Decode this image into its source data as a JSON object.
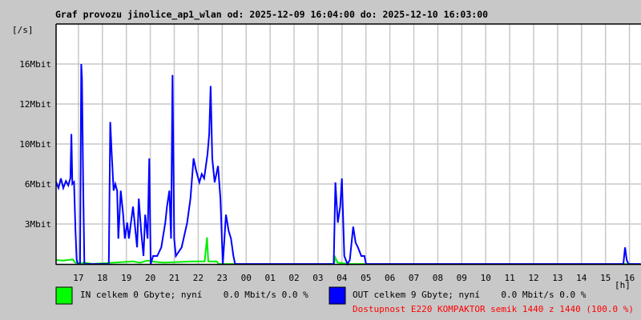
{
  "chart_data": {
    "type": "line",
    "title": "Graf provozu jinolice_ap1_wlan od: 2025-12-09 16:04:00 do: 2025-12-10 16:03:00",
    "ylabel": "[/s]",
    "xlabel": "[h]",
    "y_ticks": [
      {
        "label": "3Mbit",
        "value": 3
      },
      {
        "label": "6Mbit",
        "value": 6
      },
      {
        "label": "10Mbit",
        "value": 10
      },
      {
        "label": "12Mbit",
        "value": 12
      },
      {
        "label": "16Mbit",
        "value": 16
      }
    ],
    "x_start": "16:04",
    "x_ticks": [
      "17",
      "18",
      "19",
      "20",
      "21",
      "22",
      "23",
      "00",
      "01",
      "02",
      "03",
      "04",
      "05",
      "06",
      "07",
      "08",
      "09",
      "10",
      "11",
      "12",
      "13",
      "14",
      "15",
      "16"
    ],
    "grid": true,
    "series": [
      {
        "name": "IN",
        "color": "#00ee00",
        "points": [
          [
            0,
            0.3
          ],
          [
            0.3,
            0.25
          ],
          [
            0.5,
            0.3
          ],
          [
            0.7,
            0.35
          ],
          [
            0.8,
            0.1
          ],
          [
            1.0,
            0.05
          ],
          [
            1.2,
            0.1
          ],
          [
            1.5,
            0
          ],
          [
            3.2,
            0.2
          ],
          [
            3.5,
            0.1
          ],
          [
            3.8,
            0.25
          ],
          [
            4.2,
            0.15
          ],
          [
            4.5,
            0.1
          ],
          [
            5.7,
            0.2
          ],
          [
            6.2,
            0.2
          ],
          [
            6.3,
            2.0
          ],
          [
            6.35,
            0.2
          ],
          [
            6.7,
            0.2
          ],
          [
            6.8,
            0
          ],
          [
            11.6,
            0
          ],
          [
            11.65,
            0.5
          ],
          [
            11.75,
            0.1
          ],
          [
            12.0,
            0.05
          ],
          [
            12.3,
            0
          ],
          [
            24.4,
            0
          ]
        ]
      },
      {
        "name": "OUT",
        "color": "#0000ff",
        "points": [
          [
            0,
            6.2
          ],
          [
            0.1,
            5.7
          ],
          [
            0.2,
            6.56
          ],
          [
            0.3,
            5.7
          ],
          [
            0.41,
            6.3
          ],
          [
            0.51,
            5.9
          ],
          [
            0.6,
            6.6
          ],
          [
            0.64,
            10.5
          ],
          [
            0.68,
            6.0
          ],
          [
            0.75,
            6.2
          ],
          [
            0.81,
            2.5
          ],
          [
            0.86,
            0.3
          ],
          [
            0.91,
            0
          ],
          [
            1.0,
            0
          ],
          [
            1.05,
            16
          ],
          [
            1.08,
            14.6
          ],
          [
            1.13,
            6.0
          ],
          [
            1.18,
            0
          ],
          [
            2.2,
            0
          ],
          [
            2.26,
            11.1
          ],
          [
            2.33,
            8.56
          ],
          [
            2.4,
            5.5
          ],
          [
            2.47,
            6.0
          ],
          [
            2.55,
            5.5
          ],
          [
            2.6,
            1.9
          ],
          [
            2.7,
            5.5
          ],
          [
            2.8,
            3.7
          ],
          [
            2.87,
            1.9
          ],
          [
            2.97,
            3.1
          ],
          [
            3.04,
            1.9
          ],
          [
            3.21,
            4.3
          ],
          [
            3.38,
            1.25
          ],
          [
            3.45,
            4.9
          ],
          [
            3.55,
            2.5
          ],
          [
            3.65,
            0.6
          ],
          [
            3.72,
            3.7
          ],
          [
            3.82,
            1.9
          ],
          [
            3.89,
            8.56
          ],
          [
            3.95,
            0
          ],
          [
            4.05,
            0.6
          ],
          [
            4.22,
            0.6
          ],
          [
            4.39,
            1.25
          ],
          [
            4.56,
            3.1
          ],
          [
            4.63,
            4.3
          ],
          [
            4.73,
            5.5
          ],
          [
            4.8,
            1.9
          ],
          [
            4.86,
            14.9
          ],
          [
            4.93,
            1.9
          ],
          [
            5.0,
            0.6
          ],
          [
            5.24,
            1.25
          ],
          [
            5.47,
            3.1
          ],
          [
            5.61,
            4.9
          ],
          [
            5.74,
            8.56
          ],
          [
            5.84,
            7.4
          ],
          [
            5.98,
            6.16
          ],
          [
            6.08,
            7.0
          ],
          [
            6.18,
            6.56
          ],
          [
            6.32,
            9.0
          ],
          [
            6.39,
            10.5
          ],
          [
            6.45,
            13.8
          ],
          [
            6.52,
            8.56
          ],
          [
            6.62,
            6.16
          ],
          [
            6.76,
            7.8
          ],
          [
            6.86,
            4.9
          ],
          [
            6.96,
            0
          ],
          [
            7.09,
            3.7
          ],
          [
            7.2,
            2.5
          ],
          [
            7.3,
            1.9
          ],
          [
            7.4,
            0.6
          ],
          [
            7.47,
            0
          ],
          [
            11.59,
            0
          ],
          [
            11.66,
            6.16
          ],
          [
            11.76,
            3.1
          ],
          [
            11.86,
            4.3
          ],
          [
            11.93,
            6.56
          ],
          [
            12.03,
            0.6
          ],
          [
            12.16,
            0
          ],
          [
            12.26,
            0.3
          ],
          [
            12.4,
            2.8
          ],
          [
            12.5,
            1.6
          ],
          [
            12.6,
            1.25
          ],
          [
            12.74,
            0.6
          ],
          [
            12.87,
            0.6
          ],
          [
            12.94,
            0
          ],
          [
            23.68,
            0
          ],
          [
            23.75,
            1.25
          ],
          [
            23.82,
            0.3
          ],
          [
            23.89,
            0
          ],
          [
            24.4,
            0
          ]
        ]
      }
    ]
  },
  "legend": {
    "in_text": "IN celkem 0 Gbyte; nyní    0.0 Mbit/s 0.0 %",
    "out_text": "OUT celkem 9 Gbyte; nyní    0.0 Mbit/s 0.0 %",
    "availability": "Dostupnost E220 KOMPAKTOR semik 1440 z 1440 (100.0 %)",
    "availability_color": "#ff0000"
  }
}
